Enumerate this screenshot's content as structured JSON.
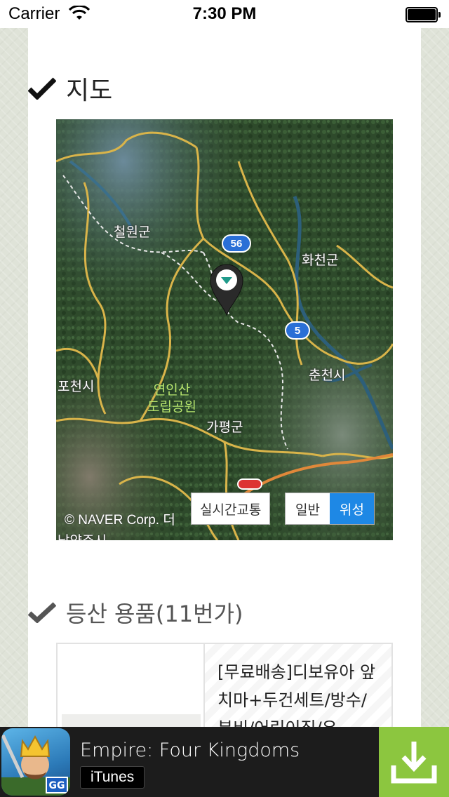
{
  "status_bar": {
    "carrier": "Carrier",
    "time": "7:30 PM"
  },
  "map_section": {
    "title": "지도",
    "labels": {
      "cheorwon": "철원군",
      "hwacheon": "화천군",
      "pocheon": "포천시",
      "park_line1": "연인산",
      "park_line2": "도립공원",
      "gapyeong": "가평군",
      "chuncheon": "춘천시",
      "namyangju": "남양주시"
    },
    "route_56": "56",
    "route_5": "5",
    "copyright": "© NAVER Corp. 더",
    "traffic_button": "실시간교통",
    "type_buttons": [
      "일반",
      "위성"
    ],
    "active_type": "위성"
  },
  "gear_section": {
    "title": "등산 용품(11번가)",
    "product_text": "[무료배송]디보유아 앞치마+두건세트/방수/분비/어린이집/유"
  },
  "ad": {
    "title": "Empire: Four Kingdoms",
    "store": "iTunes",
    "colors": {
      "download_bg": "#8cc63f",
      "bar_bg": "#1c1c1c"
    }
  },
  "colors": {
    "map_type_active": "#1e88e5",
    "route_badge": "#2a6fd6"
  }
}
